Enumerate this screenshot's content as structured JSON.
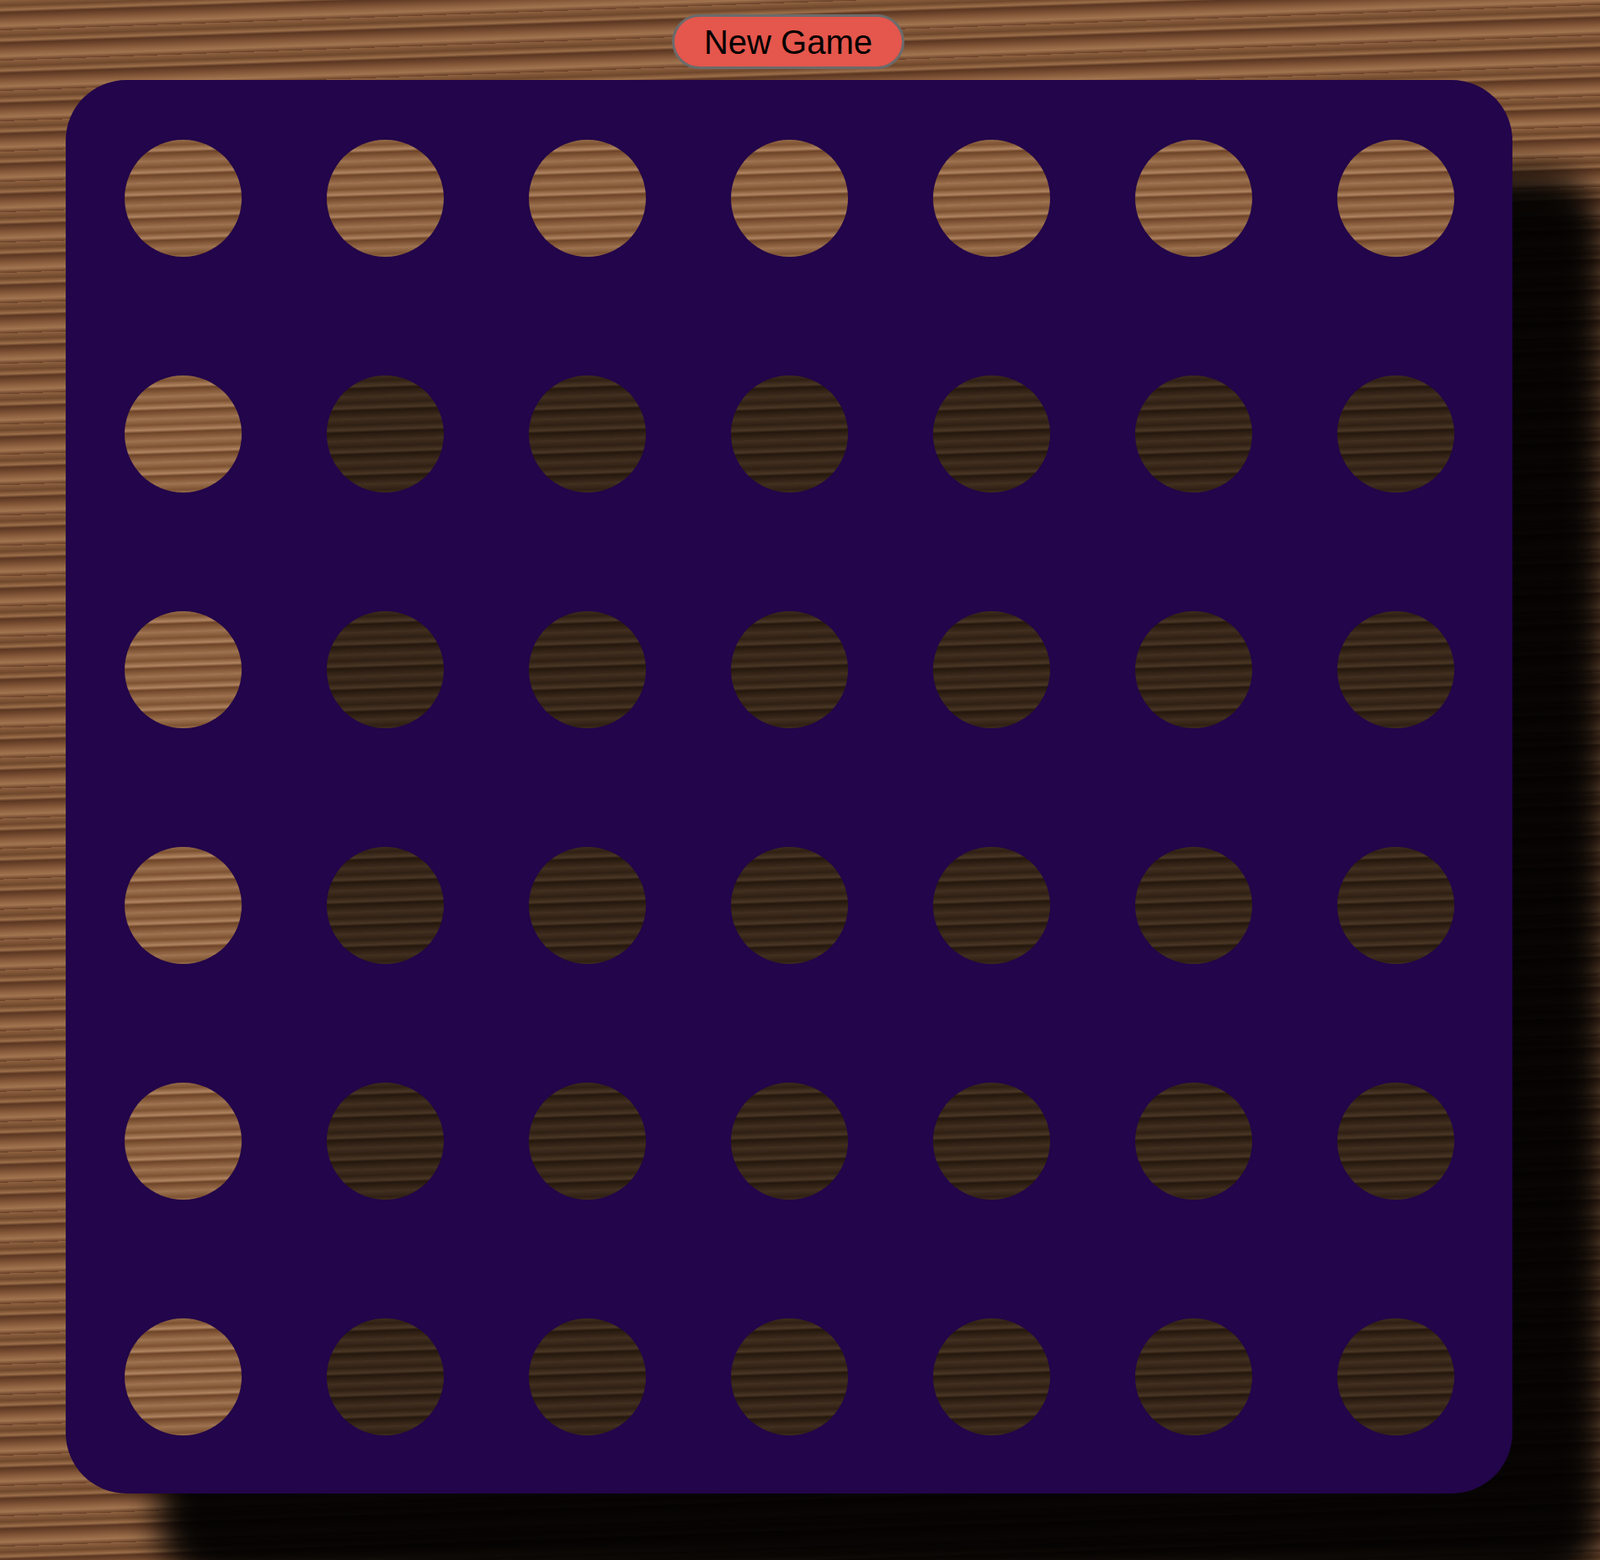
{
  "new_game_button": {
    "label": "New Game"
  },
  "board": {
    "rows": [
      [
        {
          "filled": false
        },
        {
          "filled": false
        },
        {
          "filled": false
        },
        {
          "filled": false
        },
        {
          "filled": false
        },
        {
          "filled": false
        },
        {
          "filled": false
        }
      ],
      [
        {
          "filled": false
        },
        {
          "filled": false
        },
        {
          "filled": false
        },
        {
          "filled": false
        },
        {
          "filled": false
        },
        {
          "filled": false
        },
        {
          "filled": false
        }
      ],
      [
        {
          "filled": false
        },
        {
          "filled": false
        },
        {
          "filled": false
        },
        {
          "filled": false
        },
        {
          "filled": false
        },
        {
          "filled": false
        },
        {
          "filled": false
        }
      ],
      [
        {
          "filled": false
        },
        {
          "filled": false
        },
        {
          "filled": false
        },
        {
          "filled": false
        },
        {
          "filled": false
        },
        {
          "filled": false
        },
        {
          "filled": false
        }
      ],
      [
        {
          "filled": false
        },
        {
          "filled": false
        },
        {
          "filled": false
        },
        {
          "filled": false
        },
        {
          "filled": false
        },
        {
          "filled": false
        },
        {
          "filled": false
        }
      ],
      [
        {
          "filled": false
        },
        {
          "filled": false
        },
        {
          "filled": false
        },
        {
          "filled": false
        },
        {
          "filled": false
        },
        {
          "filled": false
        },
        {
          "filled": false
        }
      ]
    ]
  }
}
